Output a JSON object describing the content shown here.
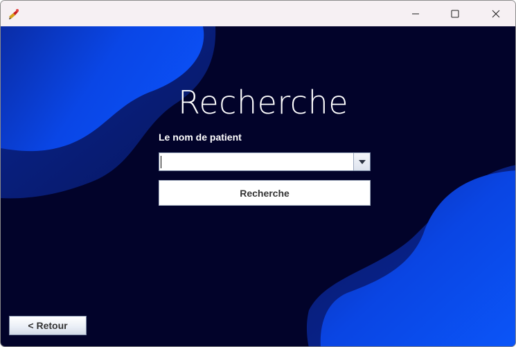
{
  "window": {
    "controls": {
      "minimize": "minimize-icon",
      "maximize": "maximize-icon",
      "close": "close-icon"
    }
  },
  "main": {
    "title": "Recherche",
    "patient_label": "Le nom de patient",
    "patient_combo": {
      "value": ""
    },
    "search_button_label": "Recherche",
    "back_button_label": "< Retour"
  },
  "colors": {
    "background": "#02032a",
    "wave_bright": "#0a4df2",
    "wave_dark": "#0a2aa8",
    "text": "#ffffff"
  }
}
